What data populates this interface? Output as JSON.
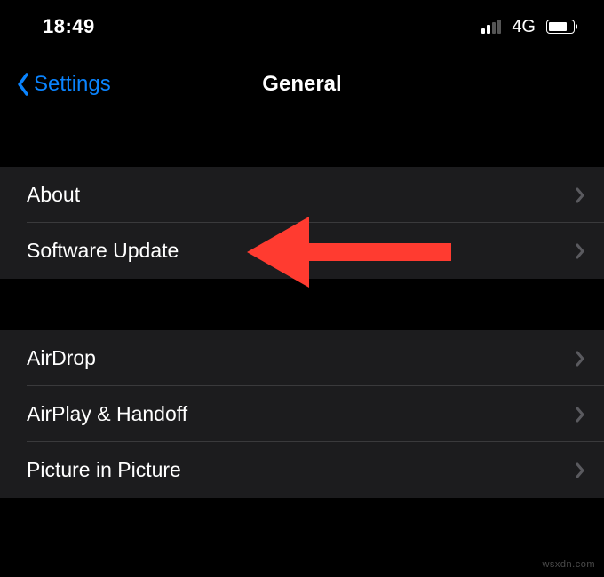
{
  "status": {
    "time": "18:49",
    "network_label": "4G"
  },
  "nav": {
    "back_label": "Settings",
    "title": "General"
  },
  "group1": {
    "items": [
      {
        "label": "About"
      },
      {
        "label": "Software Update"
      }
    ]
  },
  "group2": {
    "items": [
      {
        "label": "AirDrop"
      },
      {
        "label": "AirPlay & Handoff"
      },
      {
        "label": "Picture in Picture"
      }
    ]
  },
  "annotation": {
    "arrow_color": "#ff3b30"
  },
  "watermark": "wsxdn.com"
}
